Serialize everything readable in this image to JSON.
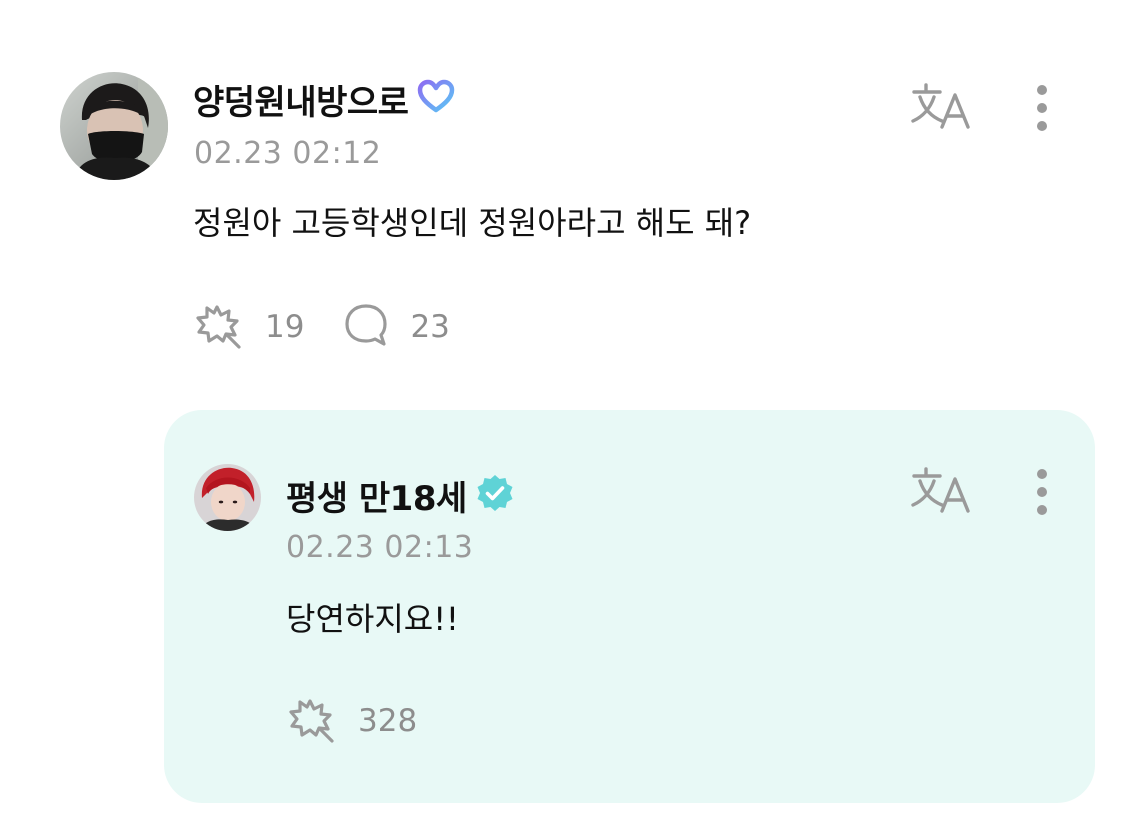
{
  "post": {
    "author": "양덩원내방으로",
    "author_badge_icon": "heart-membership-icon",
    "timestamp": "02.23 02:12",
    "text": "정원아 고등학생인데 정원아라고 해도 돼?",
    "like_count": "19",
    "comment_count": "23",
    "translate_icon": "translate-icon",
    "more_icon": "more-vertical-icon"
  },
  "reply": {
    "author": "평생 만18세",
    "author_badge_icon": "verified-icon",
    "timestamp": "02.23 02:13",
    "text": "당연하지요!!",
    "like_count": "328",
    "translate_icon": "translate-icon",
    "more_icon": "more-vertical-icon"
  },
  "colors": {
    "reply_background": "#e8f9f6",
    "verified_badge": "#5fd3d6",
    "membership_badge": "#7c6bf0",
    "muted_text": "#9a9a9a",
    "icon_gray": "#9a9a9a"
  }
}
